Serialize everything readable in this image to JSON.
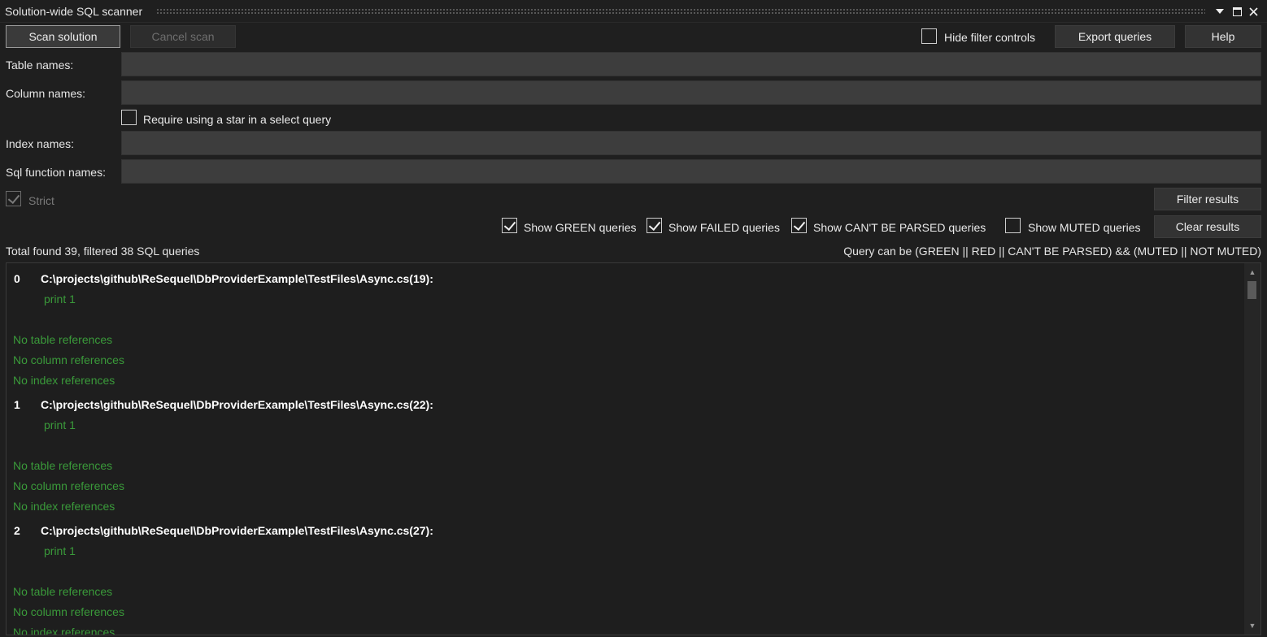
{
  "window": {
    "title": "Solution-wide SQL scanner"
  },
  "toolbar": {
    "scan_label": "Scan solution",
    "cancel_label": "Cancel scan",
    "hide_filter_label": "Hide filter controls",
    "export_label": "Export queries",
    "help_label": "Help"
  },
  "filters": {
    "table_label": "Table names:",
    "column_label": "Column names:",
    "require_star_label": "Require using a star in a select query",
    "index_label": "Index names:",
    "function_label": "Sql function names:",
    "strict_label": "Strict",
    "filter_button": "Filter results",
    "show_green_label": "Show GREEN queries",
    "show_failed_label": "Show FAILED queries",
    "show_cant_parse_label": "Show CAN'T BE PARSED queries",
    "show_muted_label": "Show MUTED queries",
    "clear_button": "Clear results"
  },
  "status": {
    "summary": "Total found 39, filtered 38 SQL queries",
    "legend": "Query can be (GREEN || RED || CAN'T BE PARSED) && (MUTED || NOT MUTED)"
  },
  "results": [
    {
      "index": "0",
      "path": "C:\\projects\\github\\ReSequel\\DbProviderExample\\TestFiles\\Async.cs(19):",
      "query": "print 1",
      "table_refs": "No table references",
      "column_refs": "No column references",
      "index_refs": "No index references"
    },
    {
      "index": "1",
      "path": "C:\\projects\\github\\ReSequel\\DbProviderExample\\TestFiles\\Async.cs(22):",
      "query": "print 1",
      "table_refs": "No table references",
      "column_refs": "No column references",
      "index_refs": "No index references"
    },
    {
      "index": "2",
      "path": "C:\\projects\\github\\ReSequel\\DbProviderExample\\TestFiles\\Async.cs(27):",
      "query": "print 1",
      "table_refs": "No table references",
      "column_refs": "No column references",
      "index_refs": "No index references"
    }
  ]
}
